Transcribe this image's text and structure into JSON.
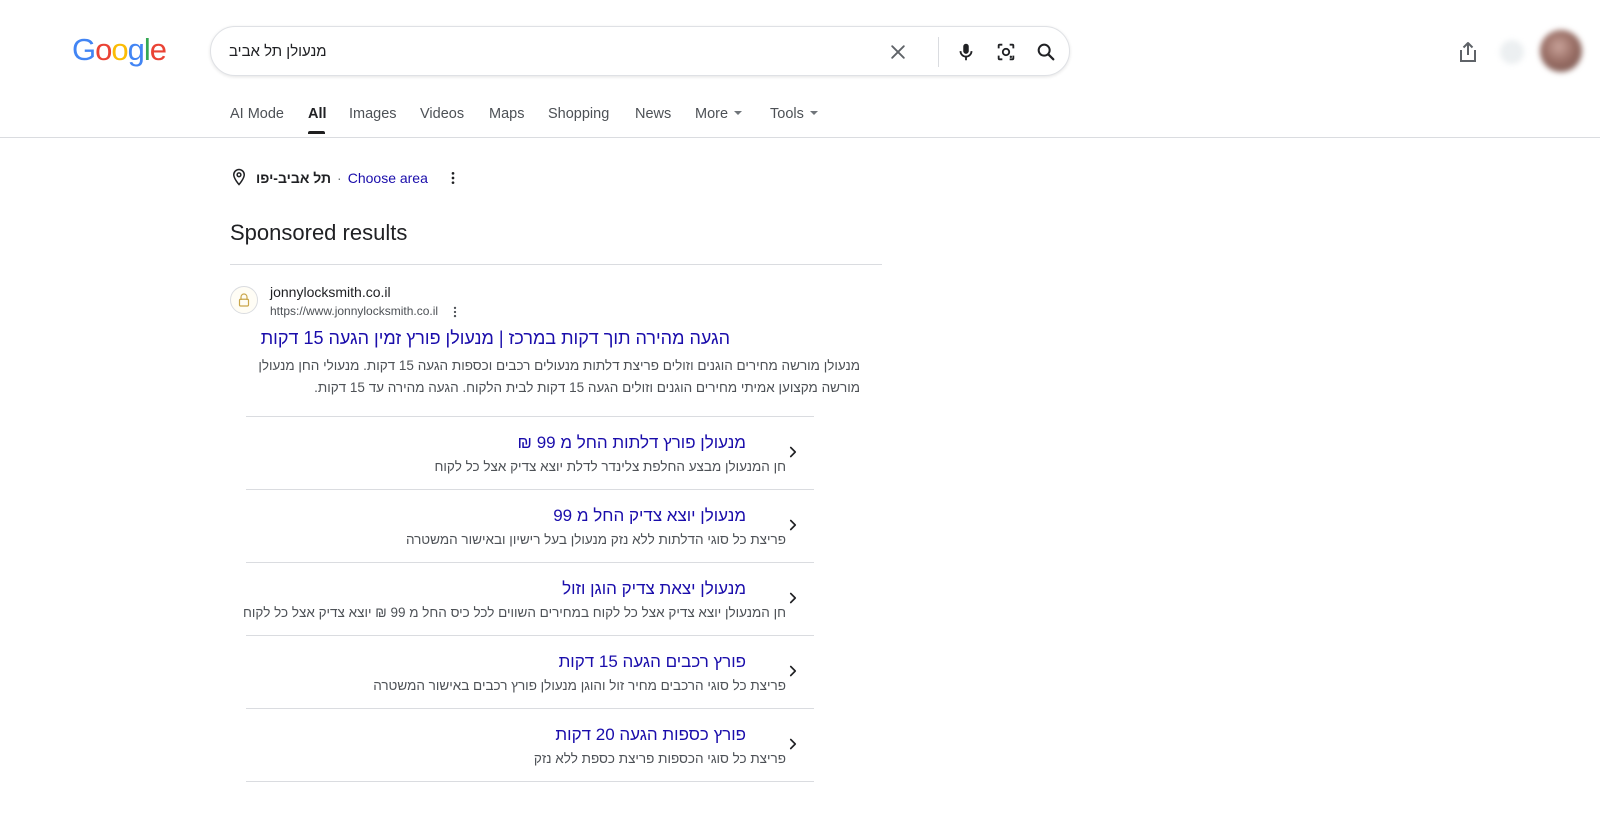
{
  "search": {
    "query": "מנעולן תל אביב"
  },
  "logo": {
    "letters": [
      "G",
      "o",
      "o",
      "g",
      "l",
      "e"
    ],
    "colors": [
      "#4285F4",
      "#EA4335",
      "#FBBC05",
      "#4285F4",
      "#34A853",
      "#EA4335"
    ]
  },
  "tabs": [
    {
      "label": "AI Mode"
    },
    {
      "label": "All"
    },
    {
      "label": "Images"
    },
    {
      "label": "Videos"
    },
    {
      "label": "Maps"
    },
    {
      "label": "Shopping"
    },
    {
      "label": "News"
    },
    {
      "label": "More"
    },
    {
      "label": "Tools"
    }
  ],
  "location": {
    "name": "תל אביב-יפו",
    "separator": "·",
    "choose_label": "Choose area"
  },
  "sponsored": {
    "heading": "Sponsored results"
  },
  "ad": {
    "site_name": "jonnylocksmith.co.il",
    "url": "https://www.jonnylocksmith.co.il",
    "title": "הגעה מהירה תוך דקות במרכז | מנעולן פורץ זמין הגעה 15 דקות",
    "description": "מנעולן מורשה מחירים הוגנים וזולים פריצת דלתות מנעולים רכבים וכספות הגעה 15 דקות. מנעולי החן מנעולן מורשה מקצוען אמיתי מחירים הוגנים וזולים הגעה 15 דקות לבית הלקוח. הגעה מהירה עד 15 דקות.",
    "sitelinks": [
      {
        "title": "מנעולן פורץ דלתות החל מ 99 ₪",
        "desc": "חן המנעולן מבצע החלפת צלינדר לדלת יוצא צדיק אצל כל לקוח"
      },
      {
        "title": "מנעולן יוצא צדיק החל מ 99",
        "desc": "פריצת כל סוגי הדלתות ללא נזק מנעולן בעל רישיון ובאישור המשטרה"
      },
      {
        "title": "מנעולן יצאת צדיק הוגן וזול",
        "desc": "חן המנעולן יוצא צדיק אצל כל לקוח במחירים השווים לכל כיס החל מ 99 ₪ יוצא צדיק אצל כל לקוח"
      },
      {
        "title": "פורץ רכבים הגעה 15 דקות",
        "desc": "פריצת כל סוגי הרכבים מחיר זול והוגן מנעולן פורץ רכבים באישור המשטרה"
      },
      {
        "title": "פורץ כספות הגעה 20 דקות",
        "desc": "פריצת כל סוגי הכספות פריצת כספת ללא נזק"
      }
    ]
  },
  "icons": {
    "clear": "close-icon",
    "voice": "microphone-icon",
    "lens": "camera-lens-icon",
    "search": "search-icon",
    "share": "share-icon",
    "location": "location-pin-icon",
    "kebab": "more-vert-icon",
    "chevron": "chevron-right-icon"
  }
}
